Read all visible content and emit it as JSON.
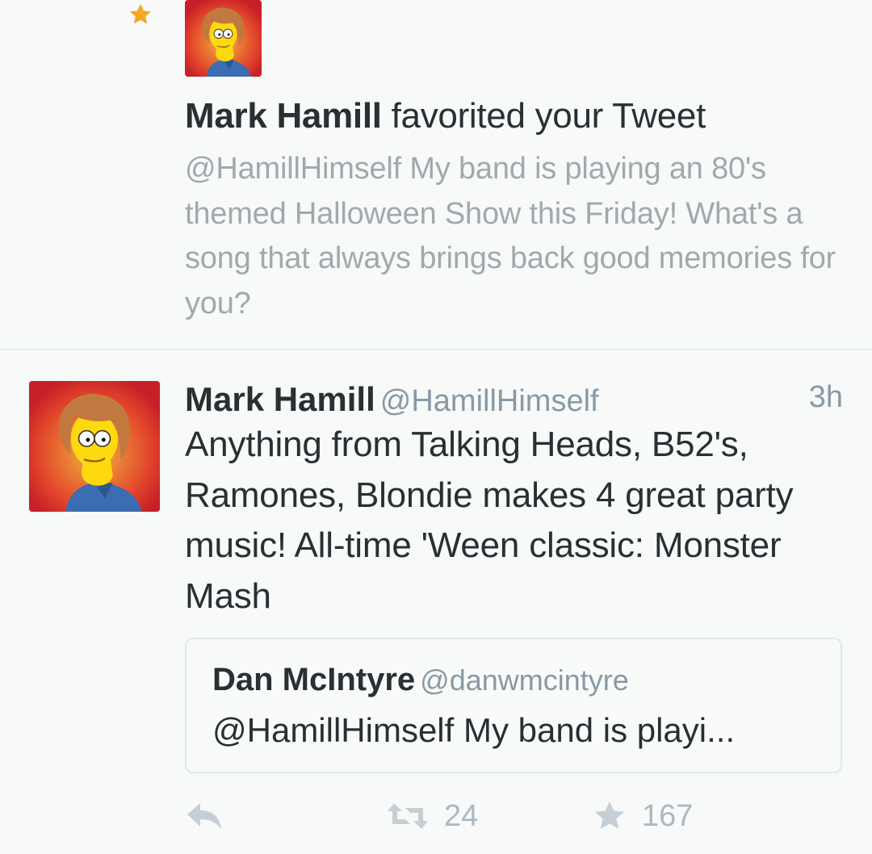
{
  "colors": {
    "star": "#f5a623",
    "text": "#292f33",
    "muted": "#a2a8ad",
    "handle": "#8899a6",
    "icons": "#aab8c2"
  },
  "notification": {
    "icon": "star-icon",
    "actor_name": "Mark Hamill",
    "action_text": " favorited your Tweet",
    "tweet_text": "@HamillHimself My band is playing an 80's themed Halloween Show this Friday! What's a song that always brings back good memories for you?"
  },
  "tweet": {
    "name": "Mark Hamill",
    "handle": "@HamillHimself",
    "time": "3h",
    "text": "Anything from Talking Heads, B52's, Ramones, Blondie makes 4 great party music! All-time 'Ween classic: Monster Mash",
    "quoted": {
      "name": "Dan McIntyre",
      "handle": "@danwmcintyre",
      "text": "@HamillHimself My band is playi..."
    },
    "actions": {
      "reply_icon": "reply-icon",
      "retweet_icon": "retweet-icon",
      "retweet_count": "24",
      "favorite_icon": "star-icon",
      "favorite_count": "167"
    }
  }
}
